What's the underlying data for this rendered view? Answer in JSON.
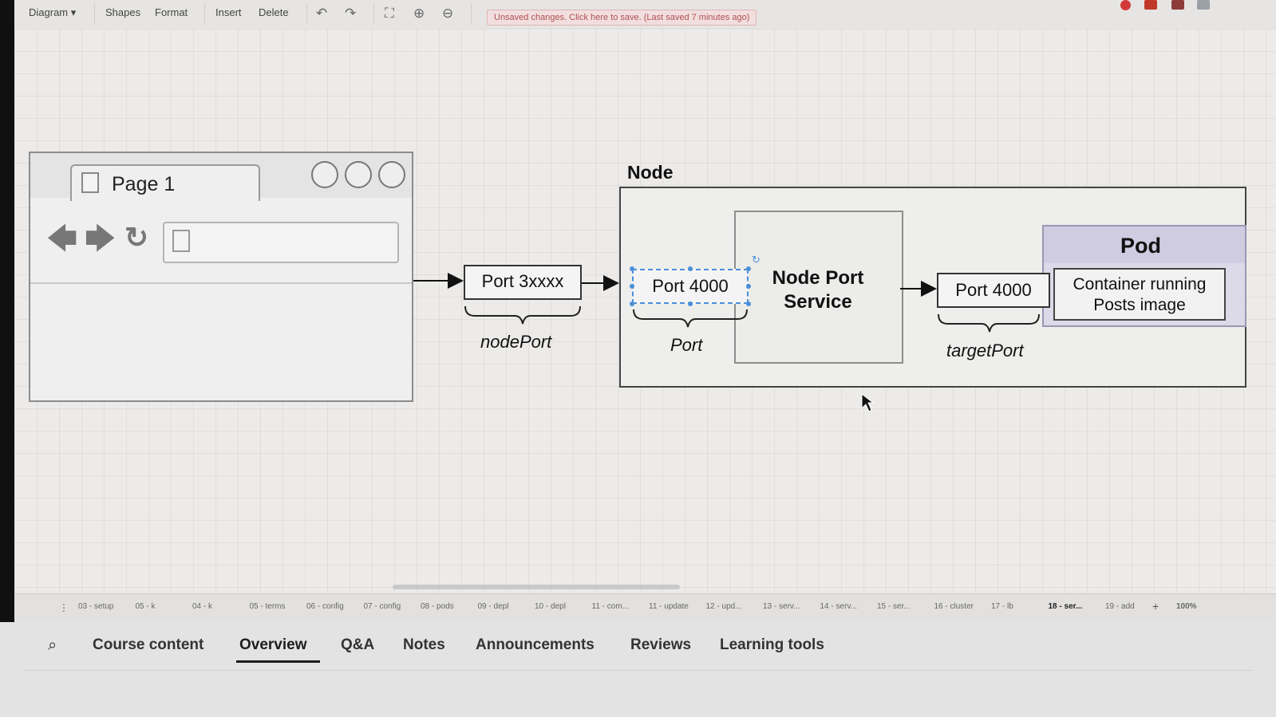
{
  "toolbar": {
    "diagram_menu": "Diagram",
    "shapes": "Shapes",
    "format": "Format",
    "insert": "Insert",
    "delete": "Delete",
    "unsaved_notice": "Unsaved changes. Click here to save. (Last saved 7 minutes ago)"
  },
  "diagram": {
    "browser": {
      "tab_title": "Page 1"
    },
    "node_title": "Node",
    "port_3xxxx": "Port 3xxxx",
    "nodeport_label": "nodePort",
    "port_4000_service": "Port 4000",
    "port_label": "Port",
    "service_label": "Node Port Service",
    "port_4000_target": "Port 4000",
    "targetport_label": "targetPort",
    "pod_title": "Pod",
    "container_label": "Container running Posts image"
  },
  "page_tabs": [
    "03 - setup",
    "05 - k",
    "04 - k",
    "05 - terms",
    "06 - config",
    "07 - config",
    "08 - pods",
    "09 - depl",
    "10 - depl",
    "11 - com...",
    "11 - update",
    "12 - upd...",
    "13 - serv...",
    "14 - serv...",
    "15 - ser...",
    "16 - cluster",
    "17 - lb",
    "18 - ser...",
    "19 - add"
  ],
  "zoom": "100%",
  "course_tabs": {
    "course_content": "Course content",
    "overview": "Overview",
    "qa": "Q&A",
    "notes": "Notes",
    "announcements": "Announcements",
    "reviews": "Reviews",
    "learning_tools": "Learning tools"
  },
  "colors": {
    "selection_blue": "#4a90d9",
    "pod_header": "#cfcbe0",
    "active_tab_underline": "#1c1d1f",
    "unsaved_text": "#b05050"
  }
}
